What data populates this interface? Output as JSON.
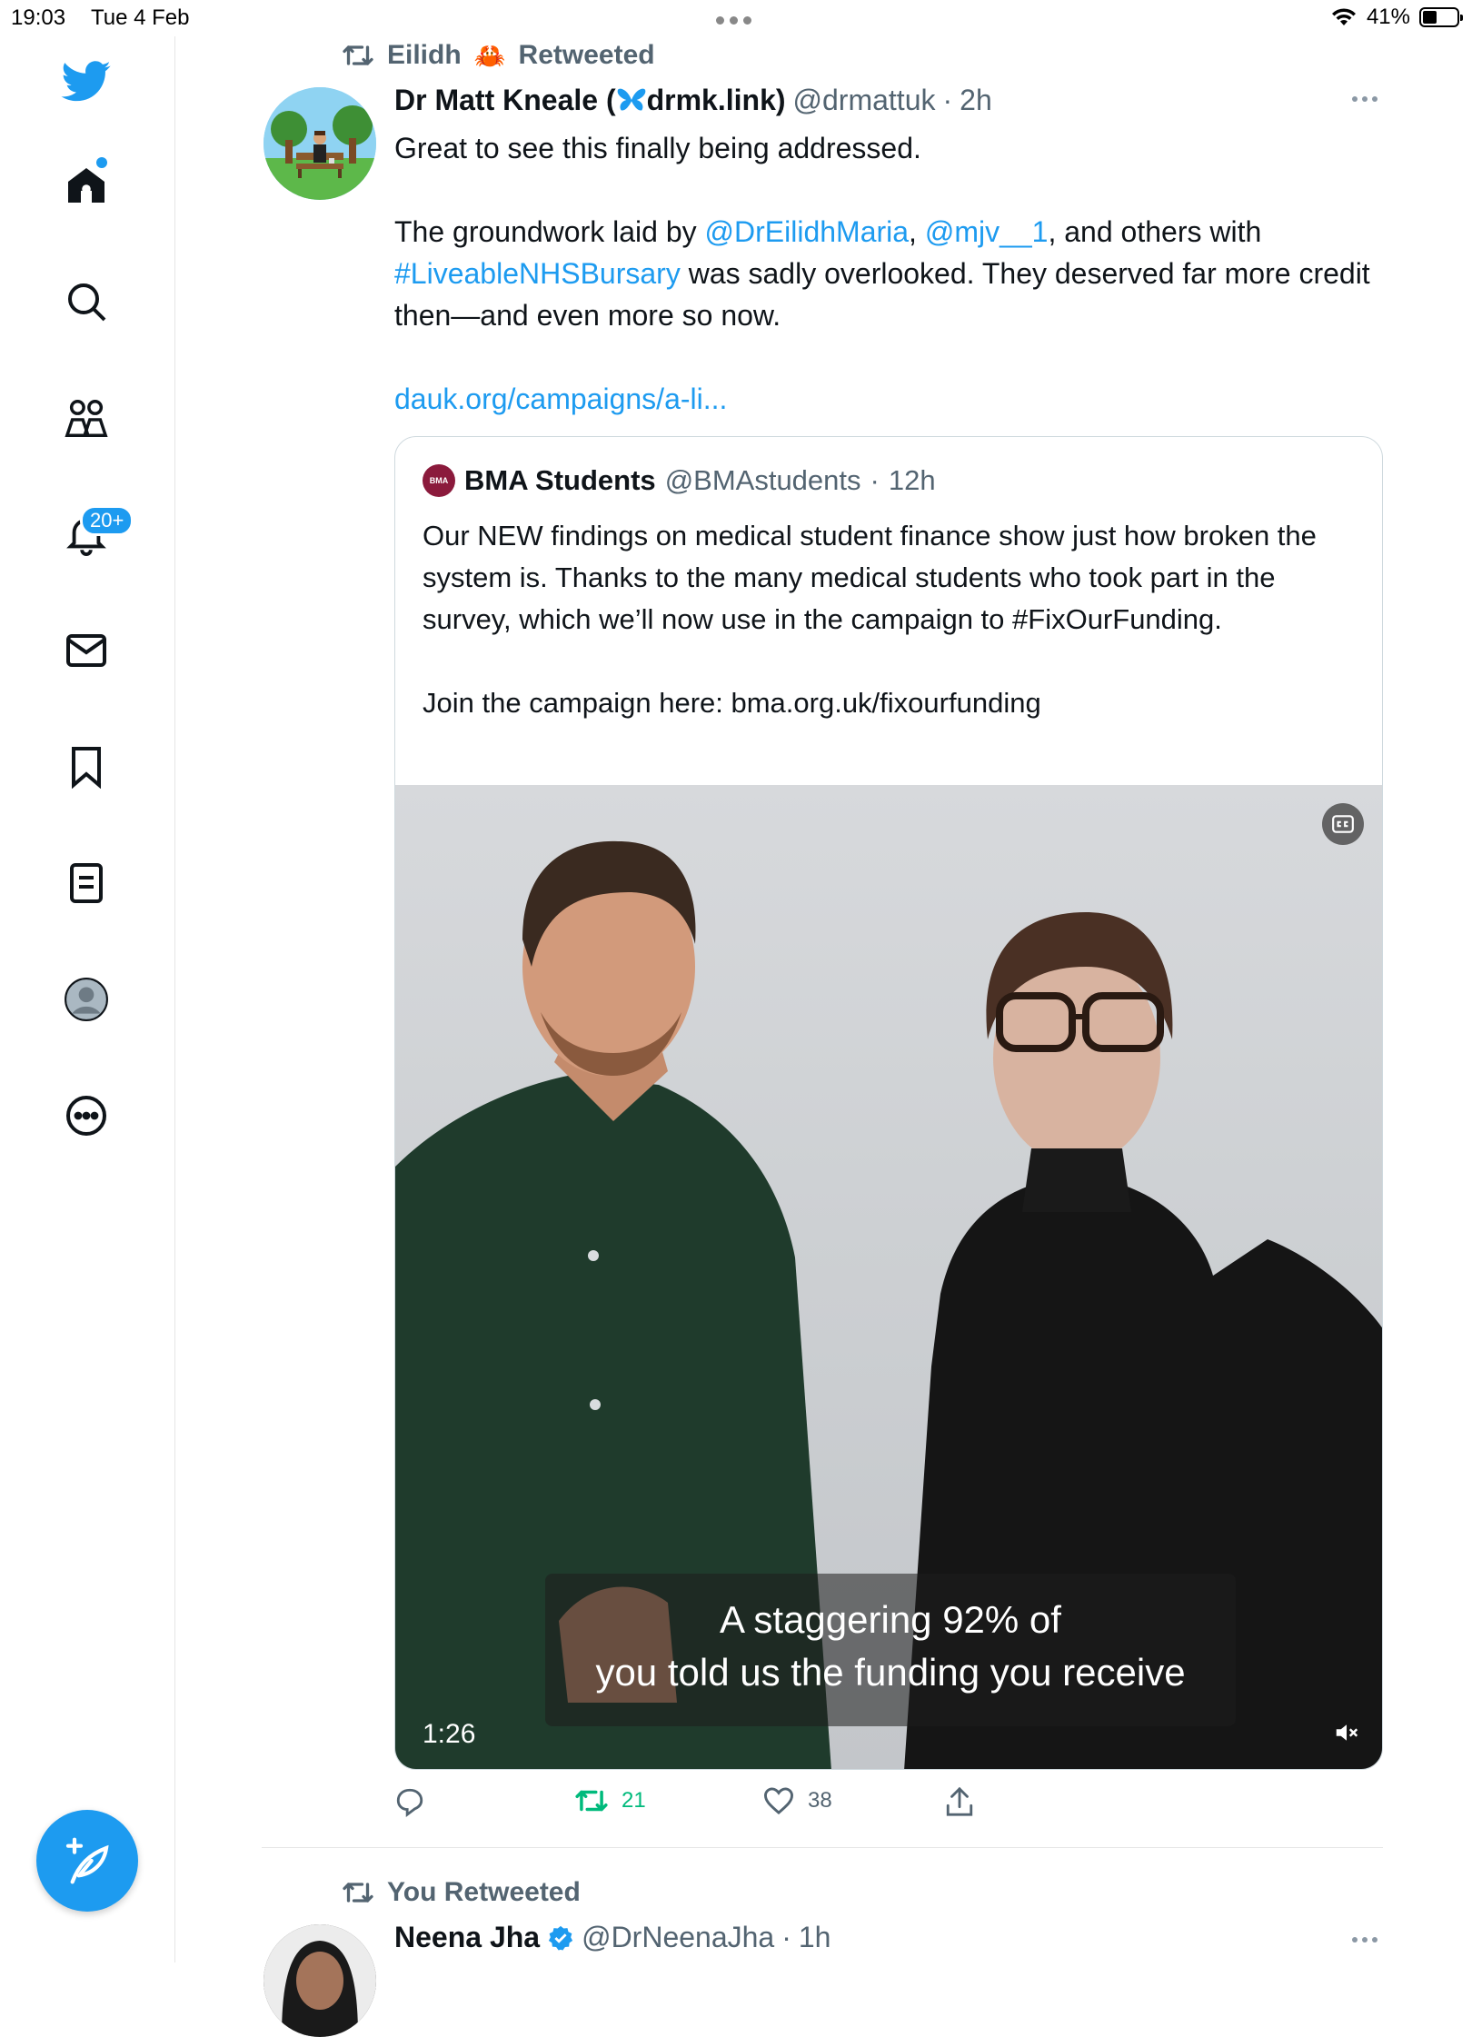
{
  "status_bar": {
    "time": "19:03",
    "date": "Tue 4 Feb",
    "battery": "41%",
    "battery_level": 0.41
  },
  "sidebar": {
    "items": [
      {
        "name": "home",
        "icon": "home-icon"
      },
      {
        "name": "explore",
        "icon": "search-icon"
      },
      {
        "name": "communities",
        "icon": "communities-icon"
      },
      {
        "name": "notifications",
        "icon": "bell-icon",
        "badge": "20+"
      },
      {
        "name": "messages",
        "icon": "mail-icon"
      },
      {
        "name": "bookmarks",
        "icon": "bookmark-icon"
      },
      {
        "name": "lists",
        "icon": "list-icon"
      },
      {
        "name": "profile",
        "icon": "profile-icon"
      },
      {
        "name": "more",
        "icon": "more-circle-icon"
      }
    ],
    "compose_icon": "compose-icon",
    "accent_color": "#1d9bf0"
  },
  "tweet": {
    "retweeted_by": "Eilidh",
    "retweeted_emoji": "🦀",
    "retweeted_label": "Retweeted",
    "author_name_prefix": "Dr Matt Kneale (",
    "author_name_suffix": "drmk.link)",
    "author_handle": "@drmattuk",
    "separator": "·",
    "time": "2h",
    "text_line1": "Great to see this finally being addressed.",
    "text_p2_a": "The groundwork laid by ",
    "mention1": "@DrEilidhMaria",
    "text_p2_b": ", ",
    "mention2": "@mjv__1",
    "text_p2_c": ", and others with",
    "hashtag": "#LiveableNHSBursary",
    "text_p2_d": " was sadly overlooked. They deserved far more credit then—and even more so now.",
    "link": "dauk.org/campaigns/a-li...",
    "quote": {
      "logo_text": "BMA",
      "name": "BMA Students",
      "handle": "@BMAstudents",
      "separator": "·",
      "time": "12h",
      "text_p1": "Our NEW findings on medical student finance show just how broken the system is. Thanks to the many medical students who took part in the survey, which we’ll now use in the campaign to #FixOurFunding.",
      "text_p2": "Join the campaign here: bma.org.uk/fixourfunding",
      "video": {
        "caption_line1": "A staggering 92% of",
        "caption_line2": "you told us the funding you receive",
        "duration": "1:26"
      }
    },
    "actions": {
      "reply_count": "",
      "retweet_count": "21",
      "like_count": "38"
    }
  },
  "next_tweet": {
    "retweeted_label": "You Retweeted",
    "author_name": "Neena Jha",
    "author_handle": "@DrNeenaJha",
    "separator": "·",
    "time": "1h"
  }
}
